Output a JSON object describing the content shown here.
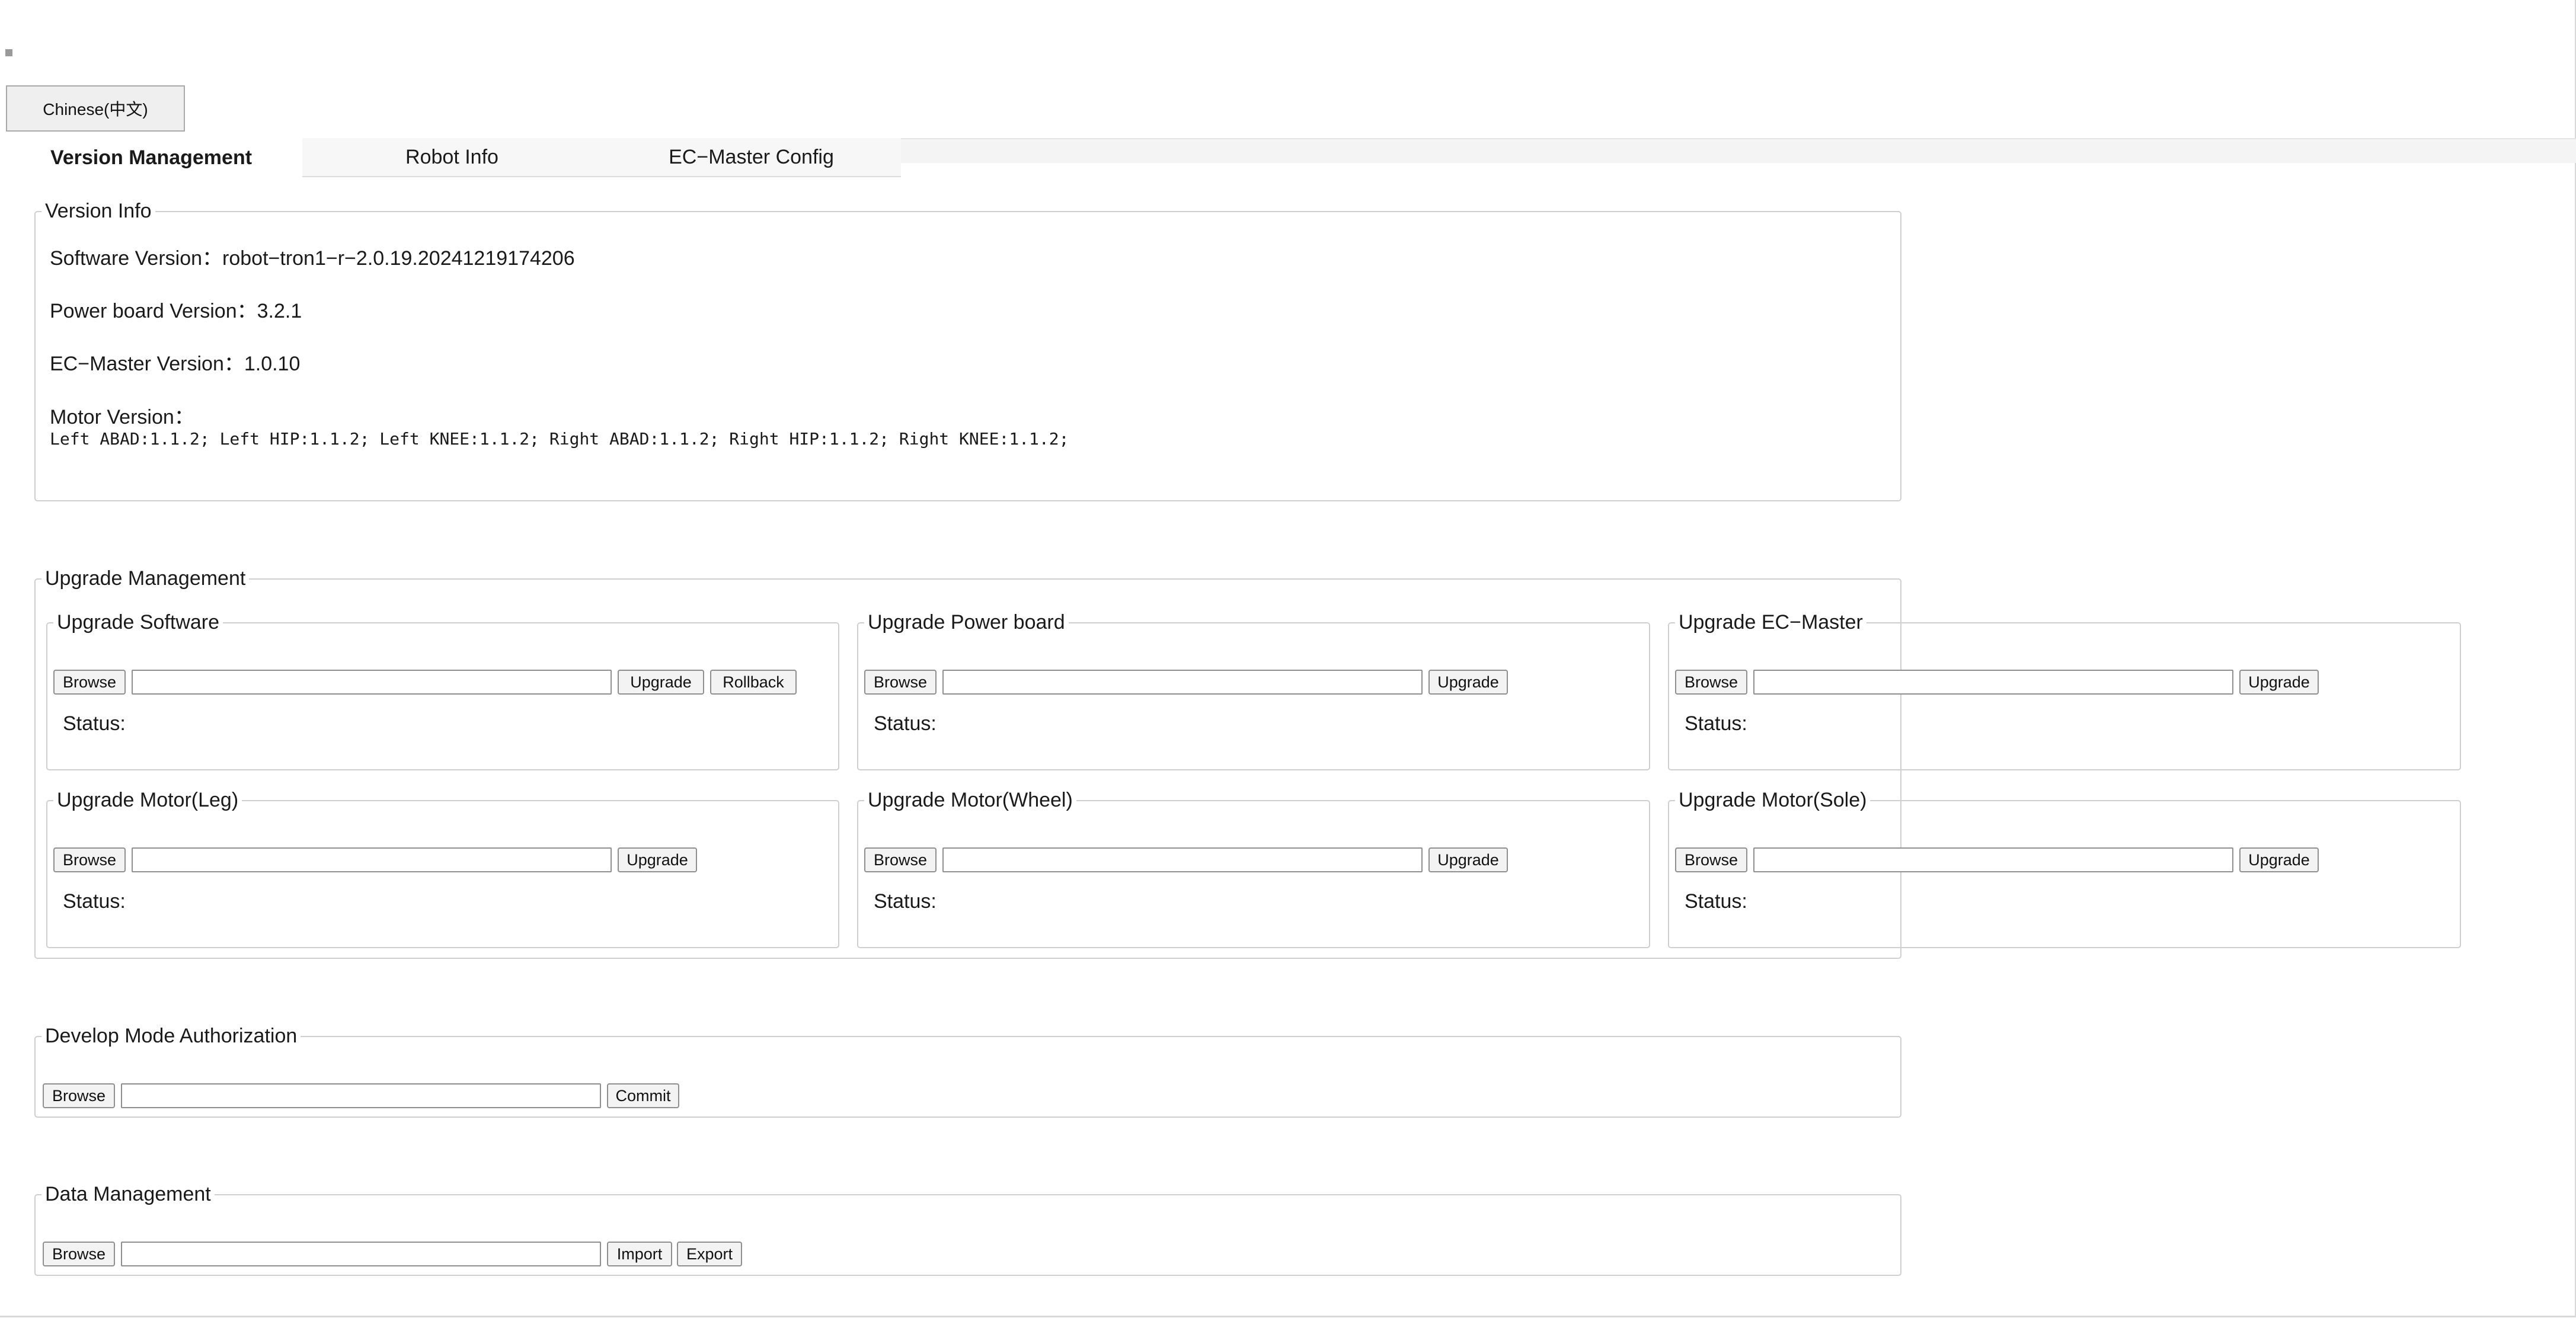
{
  "language_button": "Chinese(中文)",
  "tabs": [
    {
      "label": "Version Management"
    },
    {
      "label": "Robot Info"
    },
    {
      "label": "EC−Master Config"
    }
  ],
  "version_info": {
    "title": "Version Info",
    "software": "Software Version：robot−tron1−r−2.0.19.20241219174206",
    "power_board": "Power board Version：3.2.1",
    "ec_master": "EC−Master Version：1.0.10",
    "motor_label": "Motor Version：",
    "motor_detail": "Left ABAD:1.1.2; Left HIP:1.1.2; Left KNEE:1.1.2; Right ABAD:1.1.2; Right HIP:1.1.2; Right KNEE:1.1.2;"
  },
  "upgrade_management": {
    "title": "Upgrade Management",
    "panels": [
      {
        "title": "Upgrade Software",
        "browse": "Browse",
        "upgrade": "Upgrade",
        "rollback": "Rollback",
        "status": "Status:",
        "path": ""
      },
      {
        "title": "Upgrade Power board",
        "browse": "Browse",
        "upgrade": "Upgrade",
        "status": "Status:",
        "path": ""
      },
      {
        "title": "Upgrade EC−Master",
        "browse": "Browse",
        "upgrade": "Upgrade",
        "status": "Status:",
        "path": ""
      },
      {
        "title": "Upgrade Motor(Leg)",
        "browse": "Browse",
        "upgrade": "Upgrade",
        "status": "Status:",
        "path": ""
      },
      {
        "title": "Upgrade Motor(Wheel)",
        "browse": "Browse",
        "upgrade": "Upgrade",
        "status": "Status:",
        "path": ""
      },
      {
        "title": "Upgrade Motor(Sole)",
        "browse": "Browse",
        "upgrade": "Upgrade",
        "status": "Status:",
        "path": ""
      }
    ]
  },
  "develop_mode": {
    "title": "Develop Mode Authorization",
    "browse": "Browse",
    "commit": "Commit",
    "path": ""
  },
  "data_management": {
    "title": "Data Management",
    "browse": "Browse",
    "import": "Import",
    "export": "Export",
    "path": ""
  }
}
